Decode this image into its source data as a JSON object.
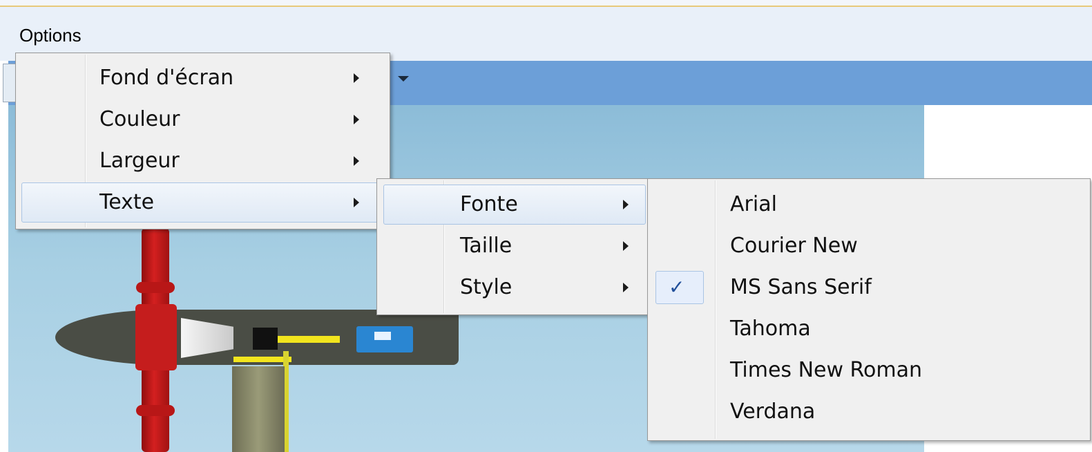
{
  "menubar": {
    "items": [
      {
        "label": "Options"
      }
    ]
  },
  "options_menu": {
    "items": [
      {
        "label": "Fond d'écran",
        "has_submenu": true
      },
      {
        "label": "Couleur",
        "has_submenu": true
      },
      {
        "label": "Largeur",
        "has_submenu": true
      },
      {
        "label": "Texte",
        "has_submenu": true,
        "selected": true
      }
    ]
  },
  "texte_menu": {
    "items": [
      {
        "label": "Fonte",
        "has_submenu": true,
        "selected": true
      },
      {
        "label": "Taille",
        "has_submenu": true
      },
      {
        "label": "Style",
        "has_submenu": true
      }
    ]
  },
  "fonte_menu": {
    "items": [
      {
        "label": "Arial",
        "checked": false
      },
      {
        "label": "Courier New",
        "checked": false
      },
      {
        "label": "MS Sans Serif",
        "checked": true
      },
      {
        "label": "Tahoma",
        "checked": false
      },
      {
        "label": "Times New Roman",
        "checked": false
      },
      {
        "label": "Verdana",
        "checked": false
      }
    ],
    "check_icon": "✓"
  },
  "colors": {
    "menu_background": "#f0f0f0",
    "menu_selection": "#dfe9f5",
    "toolbar": "#6c9fd8",
    "check_mark": "#214f9a"
  }
}
